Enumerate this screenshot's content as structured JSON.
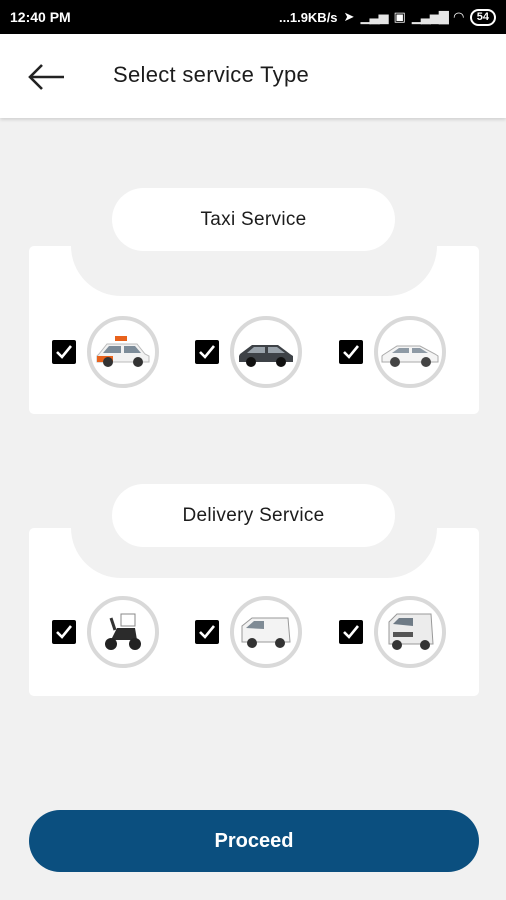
{
  "status_bar": {
    "time": "12:40 PM",
    "network_speed": "...1.9KB/s",
    "battery": "54"
  },
  "header": {
    "title": "Select service Type"
  },
  "sections": [
    {
      "title": "Taxi Service",
      "vehicles": [
        {
          "icon": "taxi-car-icon",
          "checked": true
        },
        {
          "icon": "sedan-car-icon",
          "checked": true
        },
        {
          "icon": "luxury-car-icon",
          "checked": true
        }
      ]
    },
    {
      "title": "Delivery Service",
      "vehicles": [
        {
          "icon": "scooter-icon",
          "checked": true
        },
        {
          "icon": "small-van-icon",
          "checked": true
        },
        {
          "icon": "cargo-van-icon",
          "checked": true
        }
      ]
    }
  ],
  "actions": {
    "proceed_label": "Proceed"
  },
  "colors": {
    "primary": "#0b4f7f",
    "background": "#f1f1f1",
    "card": "#ffffff",
    "checkbox": "#000000"
  }
}
